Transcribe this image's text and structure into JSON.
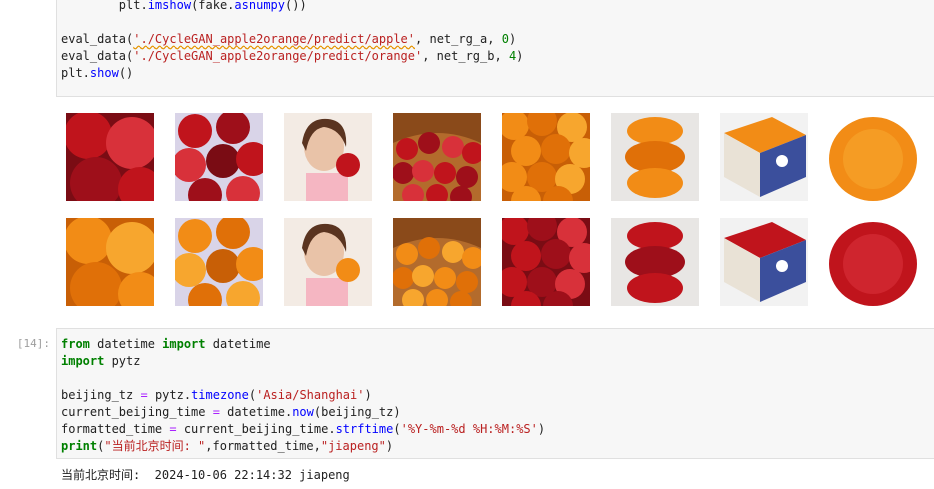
{
  "cell_a": {
    "lines": [
      {
        "parts": [
          [
            "plain",
            "        plt."
          ],
          [
            "fn",
            "imshow"
          ],
          [
            "plain",
            "(fake."
          ],
          [
            "fn",
            "asnumpy"
          ],
          [
            "plain",
            "())"
          ]
        ]
      },
      {
        "parts": [
          [
            "plain",
            ""
          ]
        ]
      },
      {
        "parts": [
          [
            "plain",
            "eval_data("
          ],
          [
            "strsq",
            "'./CycleGAN_apple2orange/predict/apple'"
          ],
          [
            "plain",
            ", net_rg_a, "
          ],
          [
            "num",
            "0"
          ],
          [
            "plain",
            ")"
          ]
        ]
      },
      {
        "parts": [
          [
            "plain",
            "eval_data("
          ],
          [
            "str",
            "'./CycleGAN_apple2orange/predict/orange'"
          ],
          [
            "plain",
            ", net_rg_b, "
          ],
          [
            "num",
            "4"
          ],
          [
            "plain",
            ")"
          ]
        ]
      },
      {
        "parts": [
          [
            "plain",
            "plt."
          ],
          [
            "fn",
            "show"
          ],
          [
            "plain",
            "()"
          ]
        ]
      }
    ]
  },
  "image_rows": [
    {
      "name": "real-images",
      "tiles": [
        {
          "kind": "red-apples-closeup"
        },
        {
          "kind": "red-apples-box"
        },
        {
          "kind": "woman-eating-red-apple"
        },
        {
          "kind": "basket-red-apples"
        },
        {
          "kind": "oranges-pile"
        },
        {
          "kind": "orange-blobs"
        },
        {
          "kind": "orange-crate"
        },
        {
          "kind": "orange-closeup"
        }
      ]
    },
    {
      "name": "fake-images",
      "tiles": [
        {
          "kind": "orange-apples-closeup"
        },
        {
          "kind": "orange-apples-box"
        },
        {
          "kind": "woman-eating-orange"
        },
        {
          "kind": "basket-orange-apples"
        },
        {
          "kind": "red-oranges-pile"
        },
        {
          "kind": "red-blobs"
        },
        {
          "kind": "red-crate"
        },
        {
          "kind": "red-closeup"
        }
      ]
    }
  ],
  "cell_b": {
    "prompt": "[14]:",
    "lines": [
      {
        "parts": [
          [
            "kw",
            "from"
          ],
          [
            "plain",
            " datetime "
          ],
          [
            "kw",
            "import"
          ],
          [
            "plain",
            " datetime"
          ]
        ]
      },
      {
        "parts": [
          [
            "kw",
            "import"
          ],
          [
            "plain",
            " pytz"
          ]
        ]
      },
      {
        "parts": [
          [
            "plain",
            ""
          ]
        ]
      },
      {
        "parts": [
          [
            "plain",
            "beijing_tz "
          ],
          [
            "op",
            "="
          ],
          [
            "plain",
            " pytz."
          ],
          [
            "fn",
            "timezone"
          ],
          [
            "plain",
            "("
          ],
          [
            "str",
            "'Asia/Shanghai'"
          ],
          [
            "plain",
            ")"
          ]
        ]
      },
      {
        "parts": [
          [
            "plain",
            "current_beijing_time "
          ],
          [
            "op",
            "="
          ],
          [
            "plain",
            " datetime."
          ],
          [
            "fn",
            "now"
          ],
          [
            "plain",
            "(beijing_tz)"
          ]
        ]
      },
      {
        "parts": [
          [
            "plain",
            "formatted_time "
          ],
          [
            "op",
            "="
          ],
          [
            "plain",
            " current_beijing_time."
          ],
          [
            "fn",
            "strftime"
          ],
          [
            "plain",
            "("
          ],
          [
            "str",
            "'%Y-%m-%d %H:%M:%S'"
          ],
          [
            "plain",
            ")"
          ]
        ]
      },
      {
        "parts": [
          [
            "kw2",
            "print"
          ],
          [
            "plain",
            "("
          ],
          [
            "str",
            "\"当前北京时间: \""
          ],
          [
            "plain",
            ",formatted_time,"
          ],
          [
            "str",
            "\"jiapeng\""
          ],
          [
            "plain",
            ")"
          ]
        ]
      }
    ]
  },
  "output": {
    "text": "当前北京时间:  2024-10-06 22:14:32 jiapeng"
  },
  "colors": {
    "keyword": "#008000",
    "string": "#ba2121",
    "function": "#0000ff",
    "operator": "#aa22ff",
    "cell_bg": "#f7f7f7"
  }
}
